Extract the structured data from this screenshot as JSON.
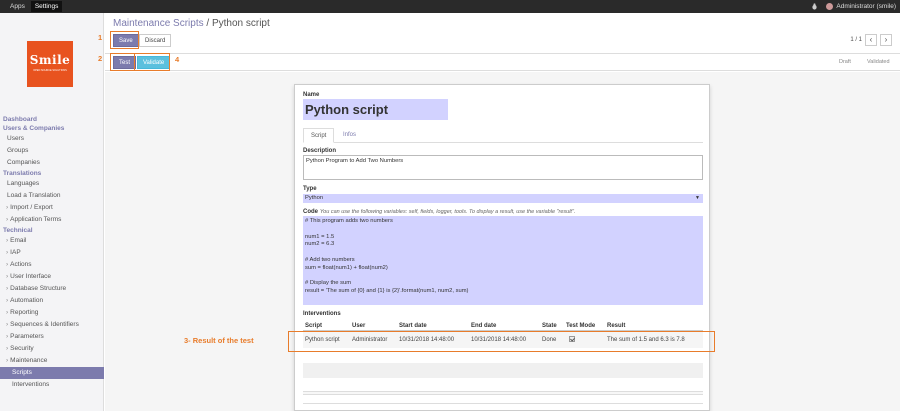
{
  "topbar": {
    "menu": [
      "Apps",
      "Settings"
    ],
    "user": "Administrator (smile)"
  },
  "logo": {
    "text": "Smile",
    "tagline": "OPEN SOURCE SOLUTIONS"
  },
  "sidebar": {
    "items": [
      {
        "label": "Dashboard",
        "kind": "hdr"
      },
      {
        "label": "Users & Companies",
        "kind": "hdr"
      },
      {
        "label": "Users",
        "kind": "item"
      },
      {
        "label": "Groups",
        "kind": "item"
      },
      {
        "label": "Companies",
        "kind": "item"
      },
      {
        "label": "Translations",
        "kind": "hdr"
      },
      {
        "label": "Languages",
        "kind": "item"
      },
      {
        "label": "Load a Translation",
        "kind": "item"
      },
      {
        "label": "Import / Export",
        "kind": "exp"
      },
      {
        "label": "Application Terms",
        "kind": "exp"
      },
      {
        "label": "Technical",
        "kind": "hdr"
      },
      {
        "label": "Email",
        "kind": "exp"
      },
      {
        "label": "IAP",
        "kind": "exp"
      },
      {
        "label": "Actions",
        "kind": "exp"
      },
      {
        "label": "User Interface",
        "kind": "exp"
      },
      {
        "label": "Database Structure",
        "kind": "exp"
      },
      {
        "label": "Automation",
        "kind": "exp"
      },
      {
        "label": "Reporting",
        "kind": "exp"
      },
      {
        "label": "Sequences & Identifiers",
        "kind": "exp"
      },
      {
        "label": "Parameters",
        "kind": "exp"
      },
      {
        "label": "Security",
        "kind": "exp"
      },
      {
        "label": "Maintenance",
        "kind": "exp"
      },
      {
        "label": "Scripts",
        "kind": "sub-item",
        "selected": true
      },
      {
        "label": "Interventions",
        "kind": "sub-item"
      }
    ]
  },
  "breadcrumb": {
    "parent": "Maintenance Scripts",
    "sep": "/",
    "current": "Python script"
  },
  "buttons": {
    "save": "Save",
    "discard": "Discard",
    "test": "Test",
    "validate": "Validate"
  },
  "pager": {
    "value": "1 / 1",
    "prev": "‹",
    "next": "›"
  },
  "stages": [
    "Draft",
    "Validated"
  ],
  "form": {
    "name_label": "Name",
    "name_value": "Python script",
    "tabs": [
      "Script",
      "Infos"
    ],
    "description_label": "Description",
    "description_value": "Python Program to Add Two Numbers",
    "type_label": "Type",
    "type_value": "Python",
    "code_label": "Code",
    "code_help": "You can use the following variables: self, fields, logger, tools. To display a result, use the variable \"result\".",
    "code_value": "# This program adds two numbers\n\nnum1 = 1.5\nnum2 = 6.3\n\n# Add two numbers\nsum = float(num1) + float(num2)\n\n# Display the sum\nresult = 'The sum of {0} and {1} is {2}'.format(num1, num2, sum)",
    "interventions_label": "Interventions"
  },
  "interventions": {
    "columns": [
      "Script",
      "User",
      "Start date",
      "End date",
      "State",
      "Test Mode",
      "Result"
    ],
    "rows": [
      {
        "script": "Python script",
        "user": "Administrator",
        "start": "10/31/2018 14:48:00",
        "end": "10/31/2018 14:48:00",
        "state": "Done",
        "result": "The sum of 1.5 and 6.3 is 7.8"
      }
    ]
  },
  "annotations": [
    "1",
    "2",
    "4",
    "3- Result of the test"
  ],
  "colors": {
    "accent": "#7c7bad",
    "annotation": "#e87c2b",
    "topbar": "#2a2a2a",
    "logo": "#e8531f"
  }
}
